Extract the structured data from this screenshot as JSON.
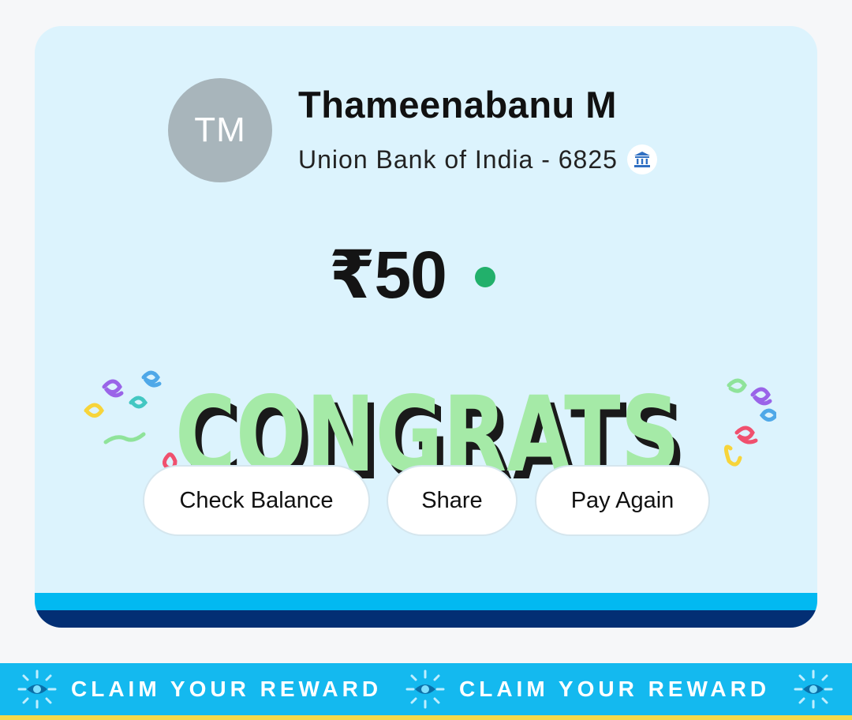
{
  "payee": {
    "initials": "TM",
    "name": "Thameenabanu M",
    "bank": "Union Bank of India - 6825",
    "bank_icon": "bank-icon"
  },
  "payment": {
    "amount": "₹50",
    "status_icon": "success-dot-icon"
  },
  "overlay": {
    "text": "CONGRATS",
    "fill_color": "#a5eaa7",
    "shadow_color": "#1a1a1a"
  },
  "actions": {
    "check_balance": "Check Balance",
    "share": "Share",
    "pay_again": "Pay Again"
  },
  "banner": {
    "text_1": "CLAIM YOUR REWARD",
    "text_2": "CLAIM YOUR REWARD",
    "icon": "sparkle-eye-icon"
  },
  "colors": {
    "card_background": "#dcf3fd",
    "stripe_light": "#02b9f1",
    "stripe_dark": "#032f74",
    "banner_background": "#14b9ef",
    "success": "#22b06b"
  }
}
